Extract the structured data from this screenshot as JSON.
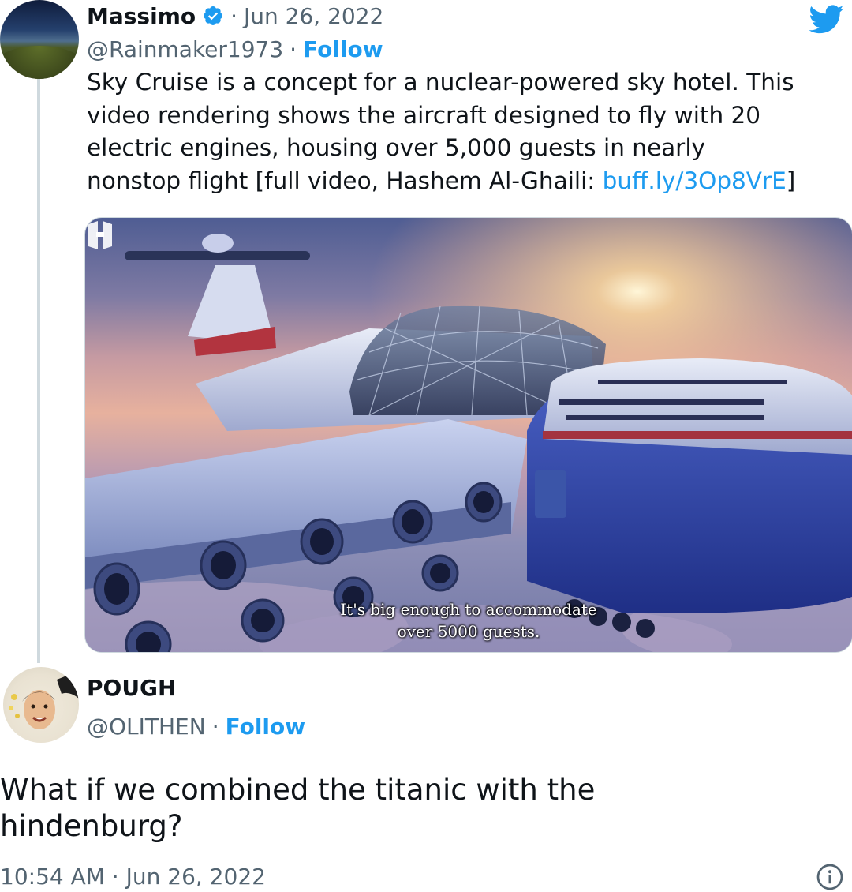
{
  "tweet": {
    "author_name": "Massimo",
    "verified": true,
    "separator": "·",
    "date": "Jun 26, 2022",
    "handle": "@Rainmaker1973",
    "follow_label": "Follow",
    "text_lines": [
      "Sky Cruise is a concept for a nuclear-powered sky hotel. This",
      "video rendering shows the aircraft designed to fly with 20",
      "electric engines, housing over 5,000 guests in nearly"
    ],
    "text_last_line_prefix": "nonstop flight [full video, Hashem Al-Ghaili: ",
    "text_link": "buff.ly/3Op8VrE",
    "text_last_line_suffix": "]",
    "media": {
      "subtitle_line1": "It's big enough to accommodate",
      "subtitle_line2": "over 5000 guests."
    }
  },
  "reply": {
    "author_name": "POUGH",
    "handle": "@OLITHEN",
    "separator": "·",
    "follow_label": "Follow",
    "text_line1": "What if we combined the titanic with the",
    "text_line2": "hindenburg?",
    "timestamp": "10:54 AM · Jun 26, 2022"
  },
  "icons": {
    "verified": "verified-badge-icon",
    "brand": "twitter-bird-icon",
    "info": "info-icon",
    "video_logo": "channel-logo-icon"
  },
  "colors": {
    "accent": "#1d9bf0",
    "text": "#0f1419",
    "secondary": "#536471"
  }
}
